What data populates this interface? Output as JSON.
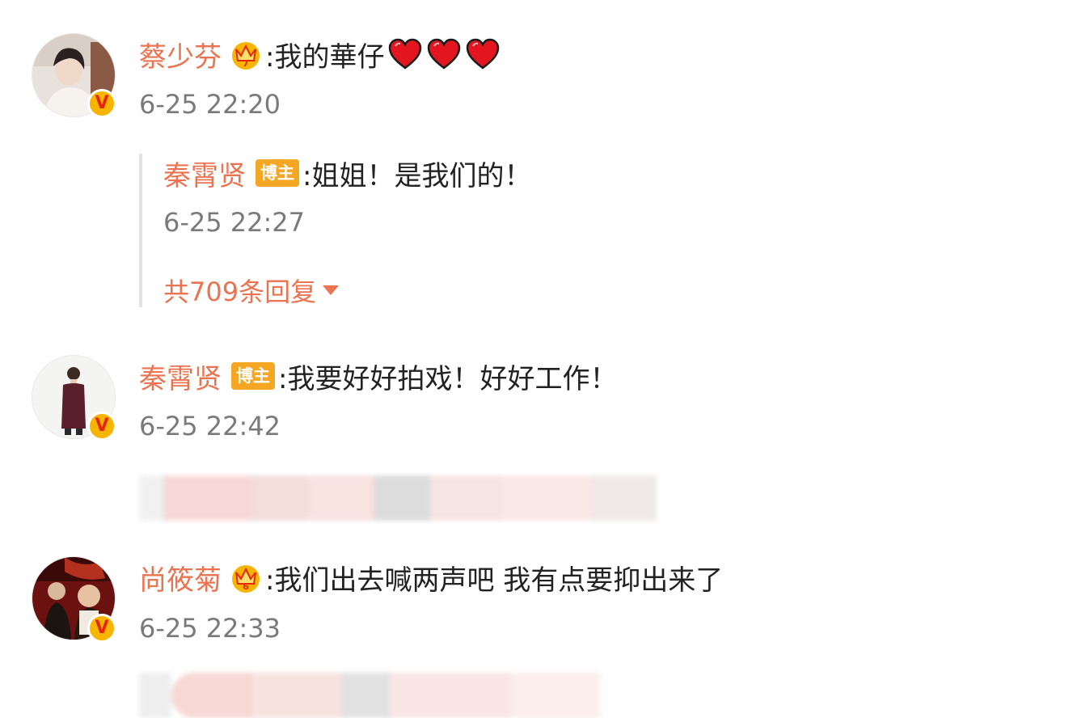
{
  "comments": [
    {
      "username": "蔡少芬",
      "content": ":我的華仔",
      "time": "6-25 22:20",
      "badge": "crown-badge",
      "hearts": 3,
      "replies": [
        {
          "username": "秦霄贤",
          "tag": "博主",
          "content": ":姐姐！是我们的！",
          "time": "6-25 22:27"
        }
      ],
      "more_replies_label": "共709条回复"
    },
    {
      "username": "秦霄贤",
      "tag": "博主",
      "content": ":我要好好拍戏！好好工作！",
      "time": "6-25 22:42"
    },
    {
      "username": "尚筱菊",
      "content": ":我们出去喊两声吧 我有点要抑出来了",
      "time": "6-25 22:33",
      "badge": "crown-badge"
    }
  ],
  "verified_badge_text": "V",
  "colors": {
    "username": "#eb7350",
    "text": "#222222",
    "time": "#7a7a7a",
    "blogger_tag_bg": "#f5a623",
    "verified_badge_bg": "#f7b500",
    "heart": "#e3151e"
  },
  "icons": {
    "heart": "red-heart-icon",
    "crown": "crown-badge-icon",
    "verified": "verified-v-icon",
    "caret": "caret-down-icon"
  }
}
